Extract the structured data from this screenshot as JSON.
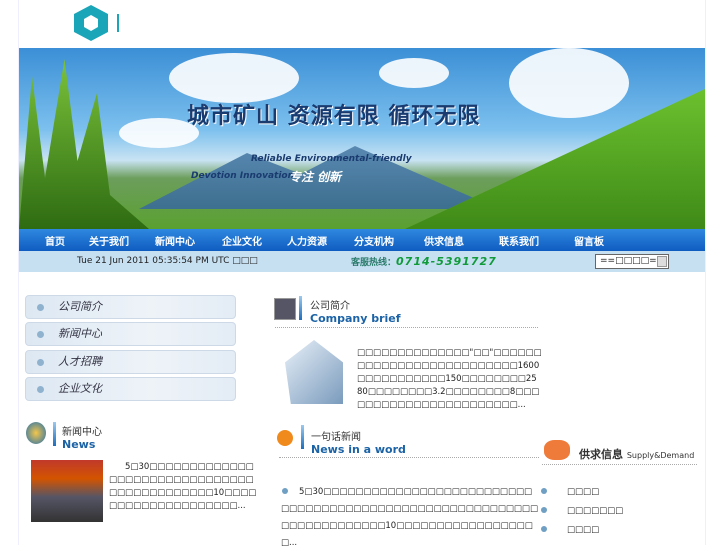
{
  "banner": {
    "slogan": "城市矿山  资源有限  循环无限",
    "tagline1": "Reliable  Environmental-friendly",
    "tagline2": "Devotion  Innovation",
    "tagline3": "专注  创新"
  },
  "nav": [
    "首页",
    "关于我们",
    "新闻中心",
    "企业文化",
    "人力资源",
    "分支机构",
    "供求信息",
    "联系我们",
    "留言板"
  ],
  "info": {
    "datetime": "Tue 21 Jun 2011 05:35:54 PM UTC □□□",
    "hotline_label": "客服热线：",
    "hotline": "0714-5391727",
    "select_value": "==□□□□=="
  },
  "sidebar": [
    "公司简介",
    "新闻中心",
    "人才招聘",
    "企业文化"
  ],
  "company": {
    "title": "公司简介",
    "subtitle": "Company brief",
    "text": "□□□□□□□□□□□□□□\"□□\"□□□□□□□□□□□□□□□□□□□□□□□□□□1600□□□□□□□□□□□150□□□□□□□□2580□□□□□□□□3.2□□□□□□□□8□□□□□□□□□□□□□□□□□□□□□□□..."
  },
  "news": {
    "title": "新闻中心",
    "subtitle": "News",
    "text": "5□30□□□□□□□□□□□□□□□□□□□□□□□□□□□□□□□□□□□□□□□□□□□□10□□□□□□□□□□□□□□□□□□□□..."
  },
  "news_word": {
    "title": "一句话新闻",
    "subtitle": "News in a word",
    "text": "5□30□□□□□□□□□□□□□□□□□□□□□□□□□□□□□□□□□□□□□□□□□□□□□□□□□□□□□□□□□□□□□□□□□□□□□□□10□□□□□□□□□□□□□□□□□□..."
  },
  "supply": {
    "title": "供求信息",
    "subtitle": "Supply&Demand",
    "items": [
      "□□□□",
      "□□□□□□□",
      "□□□□"
    ]
  }
}
